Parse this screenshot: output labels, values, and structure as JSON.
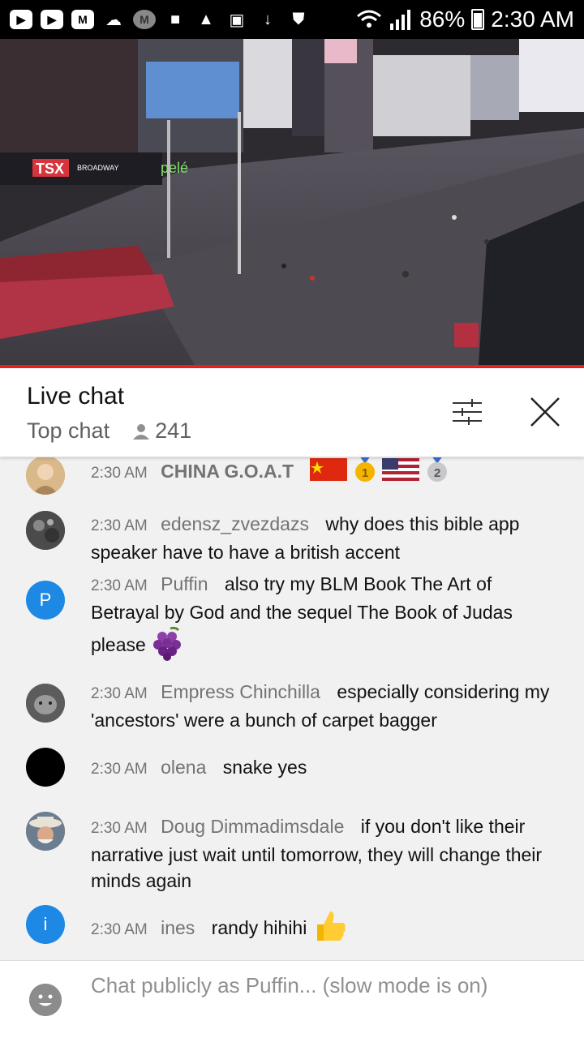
{
  "status_bar": {
    "battery": "86%",
    "time": "2:30 AM",
    "app_icons": [
      "youtube-icon",
      "youtube-icon",
      "m-app-icon",
      "cloud-icon",
      "m-app-icon",
      "folder-icon",
      "warning-icon",
      "image-icon",
      "download-icon",
      "shopping-bag-icon"
    ]
  },
  "video": {
    "signs": {
      "tsx": "TSX",
      "broadway": "BROADWAY",
      "pele": "pelé"
    }
  },
  "chat_header": {
    "title": "Live chat",
    "mode": "Top chat",
    "viewer_count": "241"
  },
  "messages": [
    {
      "time": "2:30 AM",
      "author": "CHINA G.O.A.T",
      "text": "",
      "emoji": [
        "china-flag",
        "medal-1",
        "usa-flag",
        "medal-2"
      ],
      "avatar": "photo-avatar"
    },
    {
      "time": "2:30 AM",
      "author": "edensz_zvezdazs",
      "text": "why does this bible app speaker have to have a british accent",
      "avatar": "photo-avatar"
    },
    {
      "time": "2:30 AM",
      "author": "Puffin",
      "text": "also try my BLM Book The Art of Betrayal by God and the sequel The Book of Judas please",
      "emoji": [
        "grapes"
      ],
      "avatar_letter": "P"
    },
    {
      "time": "2:30 AM",
      "author": "Empress Chinchilla",
      "text": "especially considering my 'ancestors' were a bunch of carpet bagger",
      "avatar": "photo-avatar"
    },
    {
      "time": "2:30 AM",
      "author": "olena",
      "text": "snake yes",
      "avatar": "black-avatar"
    },
    {
      "time": "2:30 AM",
      "author": "Doug Dimmadimsdale",
      "text": "if you don't like their narrative just wait until tomorrow, they will change their minds again",
      "avatar": "photo-avatar"
    },
    {
      "time": "2:30 AM",
      "author": "ines",
      "text": "randy hihihi",
      "emoji": [
        "thumbs-up"
      ],
      "avatar_letter": "i"
    }
  ],
  "input": {
    "placeholder": "Chat publicly as Puffin... (slow mode is on)"
  },
  "colors": {
    "accent_red": "#e62117",
    "avatar_blue": "#1e88e5",
    "meta_gray": "#737373"
  }
}
